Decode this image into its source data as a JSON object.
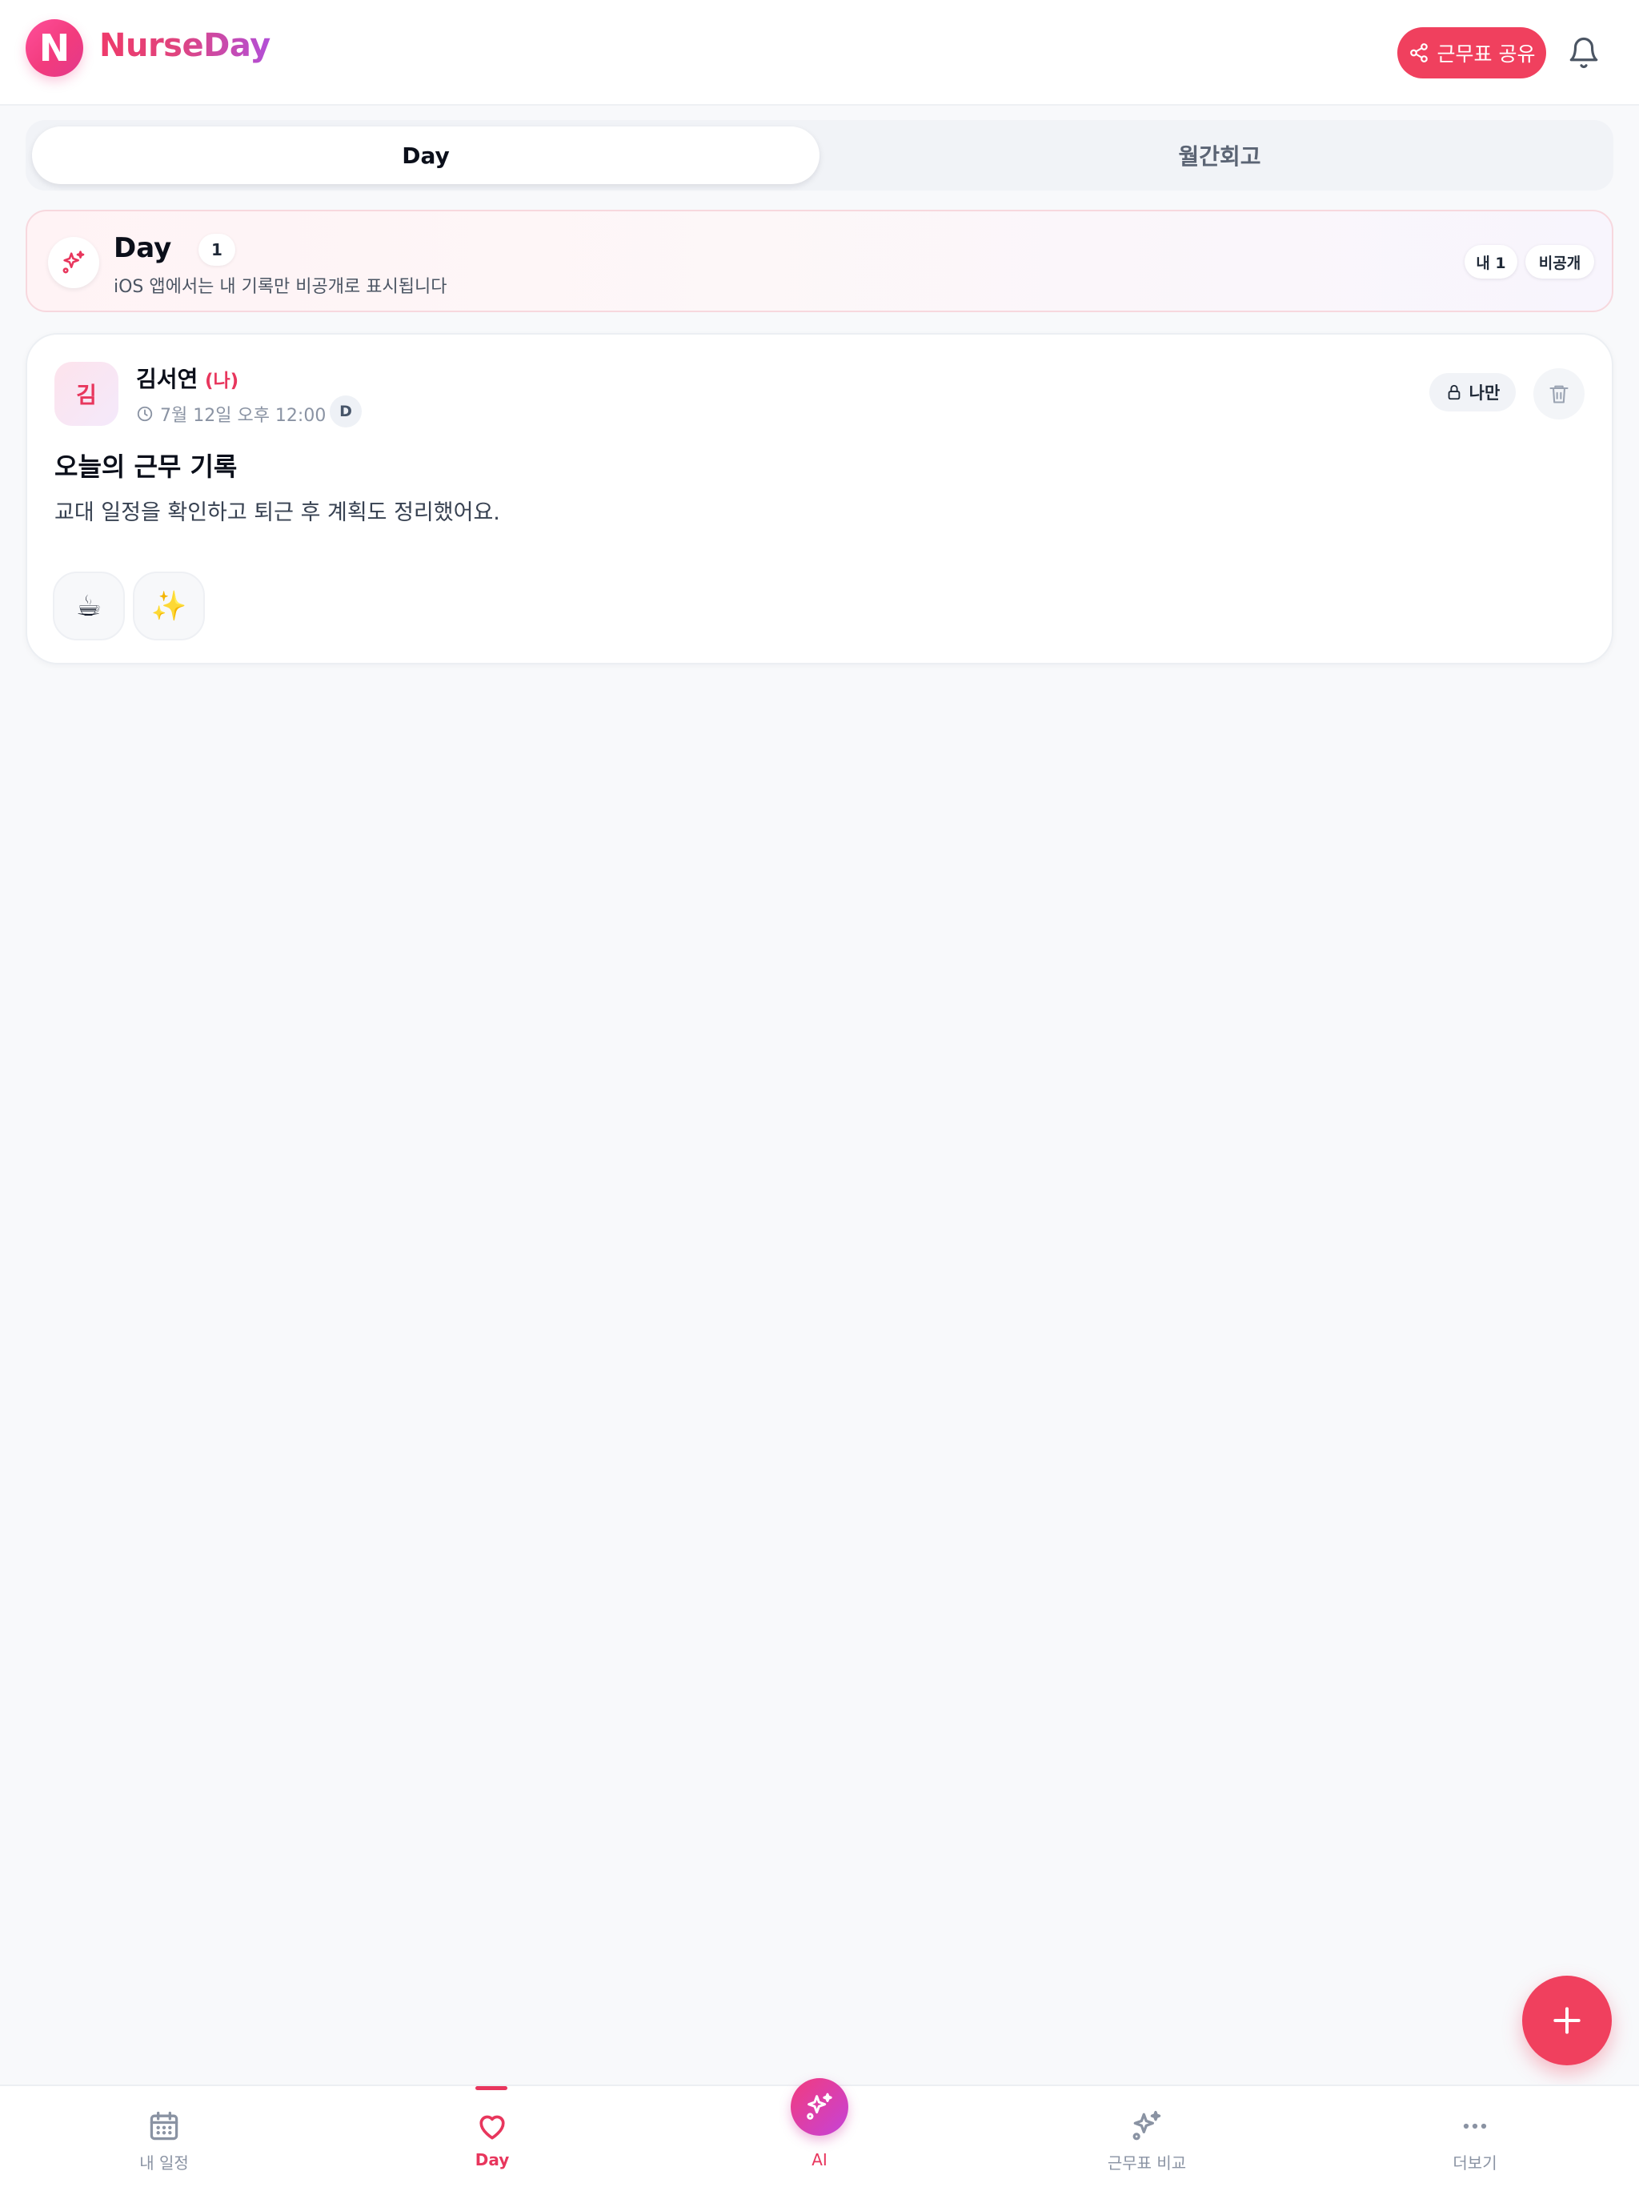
{
  "header": {
    "logo_letter": "N",
    "brand": "NurseDay",
    "share_label": "근무표 공유"
  },
  "tabs": [
    {
      "label": "Day",
      "active": true
    },
    {
      "label": "월간회고",
      "active": false
    }
  ],
  "banner": {
    "title": "Day",
    "count": "1",
    "subtitle": "iOS 앱에서는 내 기록만 비공개로 표시됩니다",
    "pill_mine": "내 1",
    "pill_private": "비공개"
  },
  "post": {
    "avatar_initial": "김",
    "author": "김서연",
    "me_tag": "(나)",
    "timestamp": "7월 12일 오후 12:00",
    "shift": "D",
    "visibility": "나만",
    "title": "오늘의 근무 기록",
    "body": "교대 일정을 확인하고 퇴근 후 계획도 정리했어요.",
    "reactions": [
      "☕",
      "✨"
    ]
  },
  "bottom_nav": [
    {
      "label": "내 일정",
      "icon": "calendar-icon"
    },
    {
      "label": "Day",
      "icon": "heart-icon",
      "active": true
    },
    {
      "label": "AI",
      "icon": "sparkle-icon"
    },
    {
      "label": "근무표 비교",
      "icon": "sparkle-outline-icon"
    },
    {
      "label": "더보기",
      "icon": "more-icon"
    }
  ],
  "colors": {
    "accent": "#f0405e",
    "accent_text": "#e8365d",
    "background": "#f8f9fb"
  }
}
